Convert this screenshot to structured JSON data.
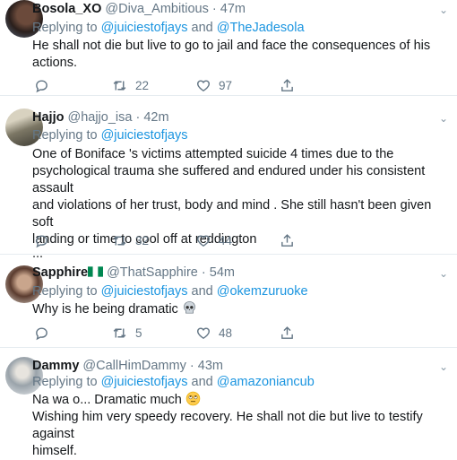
{
  "tweets": [
    {
      "name": "Bosola_XO",
      "handle": "@Diva_Ambitious",
      "time": "47m",
      "replying_prefix": "Replying to",
      "reply_to": [
        "@juiciestofjays",
        "@TheJadesola"
      ],
      "reply_joiner": "and",
      "lines": [
        "He shall not die but live to go to jail and face the consequences of his",
        "actions."
      ],
      "retweets": "22",
      "likes": "97"
    },
    {
      "name": "Hajjo",
      "handle": "@hajjo_isa",
      "time": "42m",
      "replying_prefix": "Replying to",
      "reply_to": [
        "@juiciestofjays"
      ],
      "lines": [
        "One of Boniface 's victims attempted suicide 4 times due to the",
        "psychological trauma she suffered and endured under his consistent assault",
        "and violations of her trust, body and mind . She still hasn't been given soft",
        "landing or time to cool off at reddington",
        "..."
      ],
      "retweets": "32",
      "likes": "44"
    },
    {
      "name": "Sapphire",
      "handle": "@ThatSapphire",
      "time": "54m",
      "replying_prefix": "Replying to",
      "reply_to": [
        "@juiciestofjays",
        "@okemzuruoke"
      ],
      "reply_joiner": "and",
      "lines": [
        "Why is he being dramatic"
      ],
      "retweets": "5",
      "likes": "48"
    },
    {
      "name": "Dammy",
      "handle": "@CallHimDammy",
      "time": "43m",
      "replying_prefix": "Replying to",
      "reply_to": [
        "@juiciestofjays",
        "@amazoniancub"
      ],
      "reply_joiner": "and",
      "lines": [
        "Na wa o... Dramatic much",
        "Wishing him very speedy recovery. He shall not die but live to testify against",
        "himself."
      ]
    }
  ],
  "dot": "·",
  "emojis": {
    "skull": "skull-emoji",
    "rolling_eyes": "rolling-eyes-emoji",
    "nigeria_flag": "nigeria-flag-emoji"
  },
  "colors": {
    "link": "#1b95e0",
    "secondary": "#657786",
    "text": "#14171a"
  }
}
